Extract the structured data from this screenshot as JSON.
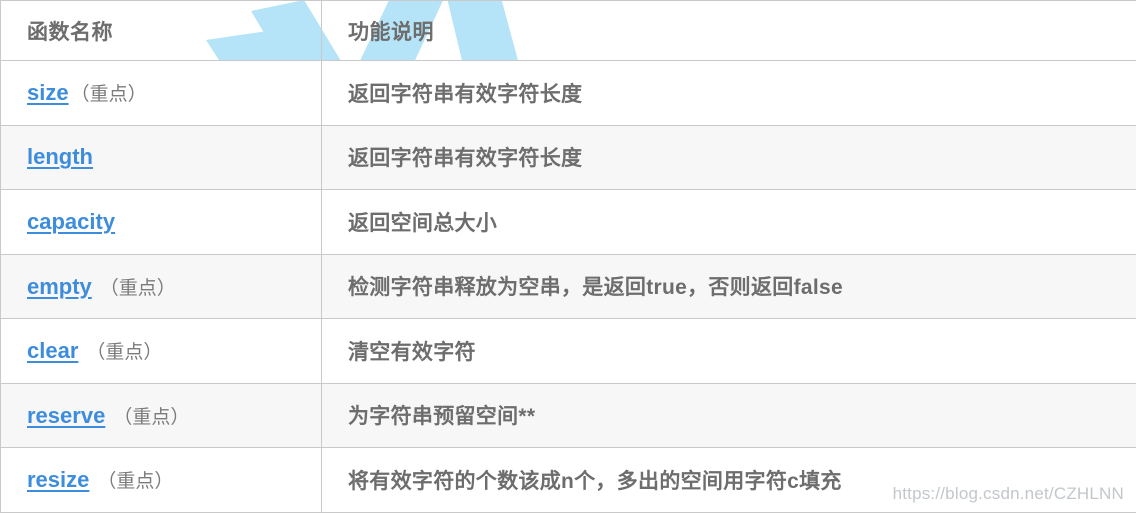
{
  "watermarks": {
    "logo_icon": "csdn-k-logo-watermark",
    "logo_color": "#b5e3f7",
    "url_text": "https://blog.csdn.net/CZHLNN",
    "url_color": "#c3c7cc"
  },
  "theme": {
    "link_color": "#3e8ddd",
    "text_color": "#6d6d6d",
    "note_color": "#7b7b7b",
    "border_color": "#c9c9c9",
    "row_white": "#ffffff",
    "row_grey": "#f7f7f7"
  },
  "table": {
    "headers": [
      "函数名称",
      "功能说明"
    ],
    "rows": [
      {
        "name": "size",
        "note": "（重点）",
        "note_gap": false,
        "desc": "返回字符串有效字符长度",
        "stripe": "white"
      },
      {
        "name": "length",
        "note": "",
        "note_gap": false,
        "desc": "返回字符串有效字符长度",
        "stripe": "grey"
      },
      {
        "name": "capacity",
        "note": "",
        "note_gap": false,
        "desc": "返回空间总大小",
        "stripe": "white"
      },
      {
        "name": "empty",
        "note": "（重点）",
        "note_gap": true,
        "desc": "检测字符串释放为空串，是返回true，否则返回false",
        "stripe": "grey"
      },
      {
        "name": "clear",
        "note": "（重点）",
        "note_gap": true,
        "desc": "清空有效字符",
        "stripe": "white"
      },
      {
        "name": "reserve",
        "note": "（重点）",
        "note_gap": true,
        "desc": "为字符串预留空间**",
        "stripe": "grey"
      },
      {
        "name": "resize",
        "note": "（重点）",
        "note_gap": true,
        "desc": "将有效字符的个数该成n个，多出的空间用字符c填充",
        "stripe": "white"
      }
    ]
  }
}
